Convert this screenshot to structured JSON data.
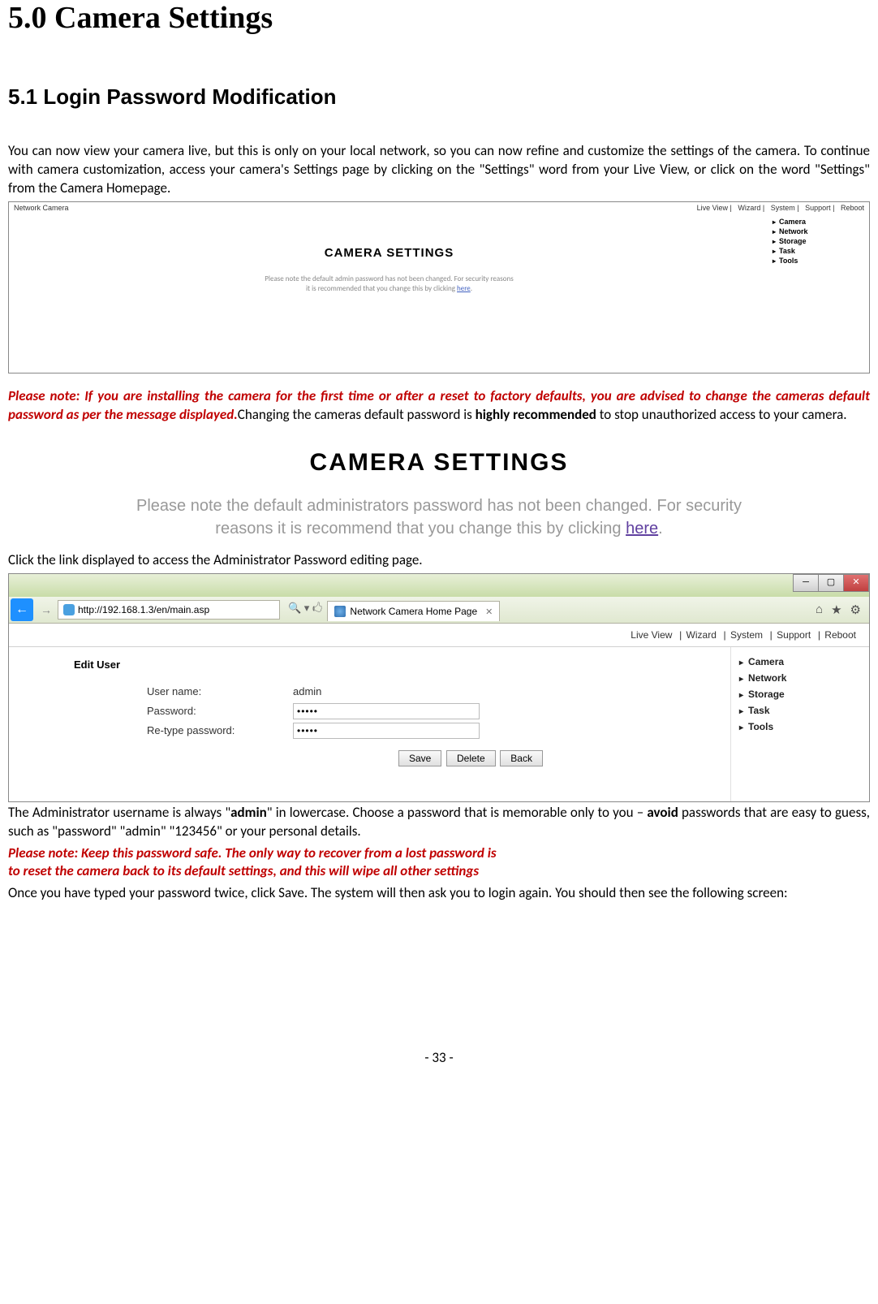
{
  "heading1": "5.0 Camera Settings",
  "heading2": "5.1 Login Password Modification",
  "intro": "You can now view your camera live, but this is only on your local network, so you can now refine and customize the settings of the camera. To continue with camera customization, access your camera's Settings page by clicking on the \"Settings\" word from your Live View, or click on the word \"Settings\" from the Camera Homepage.",
  "note1_red": "Please note: If you are installing the camera for the first time or after a reset to factory defaults, you are advised to change the cameras default password as per the message displayed.",
  "note1_black_a": "Changing the cameras default password is ",
  "note1_bold": "highly recommended",
  "note1_black_b": " to stop unauthorized access to your camera.",
  "click_link_text": "Click the link displayed to access the Administrator Password editing page.",
  "para_admin_a": "The Administrator username is always \"",
  "para_admin_bold1": "admin",
  "para_admin_b": "\" in lowercase. Choose a password that is memorable only to you – ",
  "para_admin_bold2": "avoid",
  "para_admin_c": " passwords that are easy to guess, such as \"password\" \"admin\" \"123456\" or your personal details.",
  "note2_line1": "Please note: Keep this password safe. The only way to recover from a lost password is",
  "note2_line2": "to reset the camera back to its default settings, and this will wipe all other settings",
  "para_save": "Once you have typed your password twice, click Save. The system will then ask you to login again. You should then see the following screen:",
  "page_number": "- 33 -",
  "sc1": {
    "brand": "Network Camera",
    "nav": [
      "Live View",
      "Wizard",
      "System",
      "Support",
      "Reboot"
    ],
    "title": "CAMERA SETTINGS",
    "msg1": "Please note the default admin password has not been changed. For security reasons",
    "msg2": "it is recommended that you change this by clicking ",
    "here": "here",
    "side": [
      "Camera",
      "Network",
      "Storage",
      "Task",
      "Tools"
    ]
  },
  "sc2": {
    "title": "CAMERA SETTINGS",
    "msg1": "Please note the default administrators password has not been changed. For security",
    "msg2": "reasons it is recommend that you change this by clicking ",
    "here": "here"
  },
  "sc3": {
    "url": "http://192.168.1.3/en/main.asp",
    "search_glyph": "🔍 ▾ 🖒",
    "tab_title": "Network Camera Home Page",
    "win_min": "─",
    "win_max": "▢",
    "win_close": "✕",
    "nav_back": "←",
    "nav_fwd": "→",
    "tool_home": "⌂",
    "tool_star": "★",
    "tool_gear": "⚙",
    "pagebar": [
      "Live View",
      "Wizard",
      "System",
      "Support",
      "Reboot"
    ],
    "panel_title": "Edit User",
    "lbl_user": "User name:",
    "lbl_pass": "Password:",
    "lbl_pass2": "Re-type password:",
    "val_user": "admin",
    "val_pass": "•••••",
    "val_pass2": "•••••",
    "btn_save": "Save",
    "btn_delete": "Delete",
    "btn_back": "Back",
    "side": [
      "Camera",
      "Network",
      "Storage",
      "Task",
      "Tools"
    ]
  }
}
